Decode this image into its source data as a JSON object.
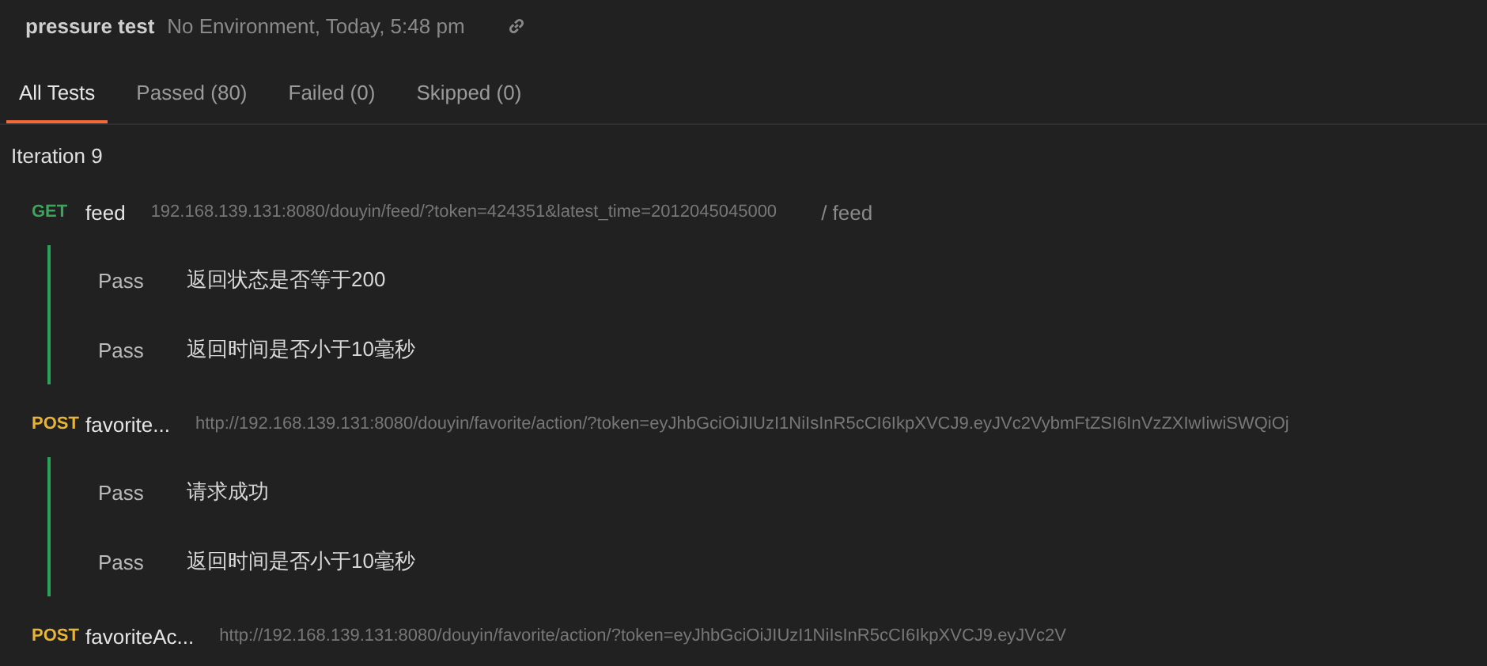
{
  "header": {
    "title": "pressure test",
    "meta": "No Environment, Today, 5:48 pm"
  },
  "tabs": [
    {
      "label": "All Tests",
      "selected": true
    },
    {
      "label": "Passed (80)",
      "selected": false
    },
    {
      "label": "Failed (0)",
      "selected": false
    },
    {
      "label": "Skipped (0)",
      "selected": false
    }
  ],
  "iteration": "Iteration 9",
  "requests": [
    {
      "method": "GET",
      "name": "feed",
      "url": "192.168.139.131:8080/douyin/feed/?token=424351&latest_time=2012045045000",
      "path": "/ feed",
      "tests": [
        {
          "status": "Pass",
          "passed": true,
          "name": "返回状态是否等于200"
        },
        {
          "status": "Pass",
          "passed": true,
          "name": "返回时间是否小于10毫秒"
        }
      ]
    },
    {
      "method": "POST",
      "name": "favorite...",
      "url": "http://192.168.139.131:8080/douyin/favorite/action/?token=eyJhbGciOiJIUzI1NiIsInR5cCI6IkpXVCJ9.eyJVc2VybmFtZSI6InVzZXIwIiwiSWQiOj",
      "tests": [
        {
          "status": "Pass",
          "passed": true,
          "name": "请求成功"
        },
        {
          "status": "Pass",
          "passed": true,
          "name": "返回时间是否小于10毫秒"
        }
      ]
    },
    {
      "method": "POST",
      "name": "favoriteAc...",
      "url": "http://192.168.139.131:8080/douyin/favorite/action/?token=eyJhbGciOiJIUzI1NiIsInR5cCI6IkpXVCJ9.eyJVc2V"
    }
  ]
}
